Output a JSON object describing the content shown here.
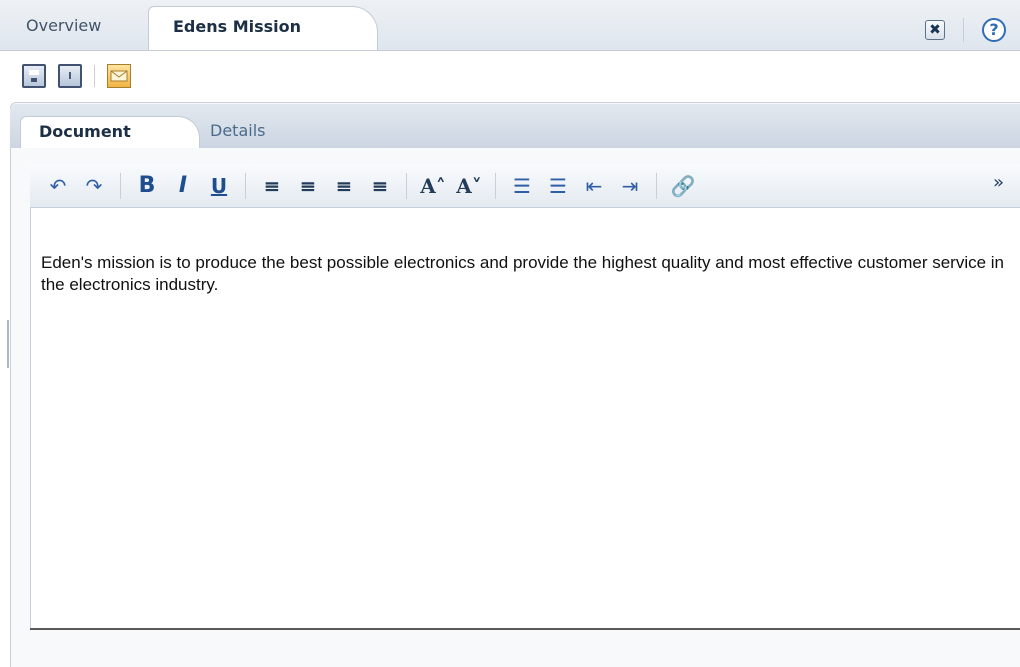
{
  "tabs": {
    "overview": "Overview",
    "active": "Edens Mission"
  },
  "header_tools": {
    "close": "✖",
    "help": "?"
  },
  "toolbar": {
    "save_icon": "save-icon",
    "save_as_icon": "save-as-icon",
    "email_icon": "email-icon",
    "saveas_glyph": "I"
  },
  "doc_tabs": {
    "document": "Document",
    "details": "Details"
  },
  "editor_toolbar": {
    "undo": "↶",
    "redo": "↷",
    "bold": "B",
    "italic": "I",
    "underline": "U",
    "align_left": "≡",
    "align_center": "≡",
    "align_right": "≡",
    "justify": "≡",
    "font_grow": "A˄",
    "font_shrink": "A˅",
    "ordered_list": "☰",
    "unordered_list": "☰",
    "outdent": "⇤",
    "indent": "⇥",
    "link": "🔗",
    "more": "»"
  },
  "editor": {
    "content": "Eden's mission is to produce the best possible electronics and provide the highest quality and most effective customer service in the electronics industry."
  },
  "colors": {
    "accent": "#2f6eb5",
    "tab_bg": "#dfe6ee",
    "border": "#c6cfda"
  }
}
